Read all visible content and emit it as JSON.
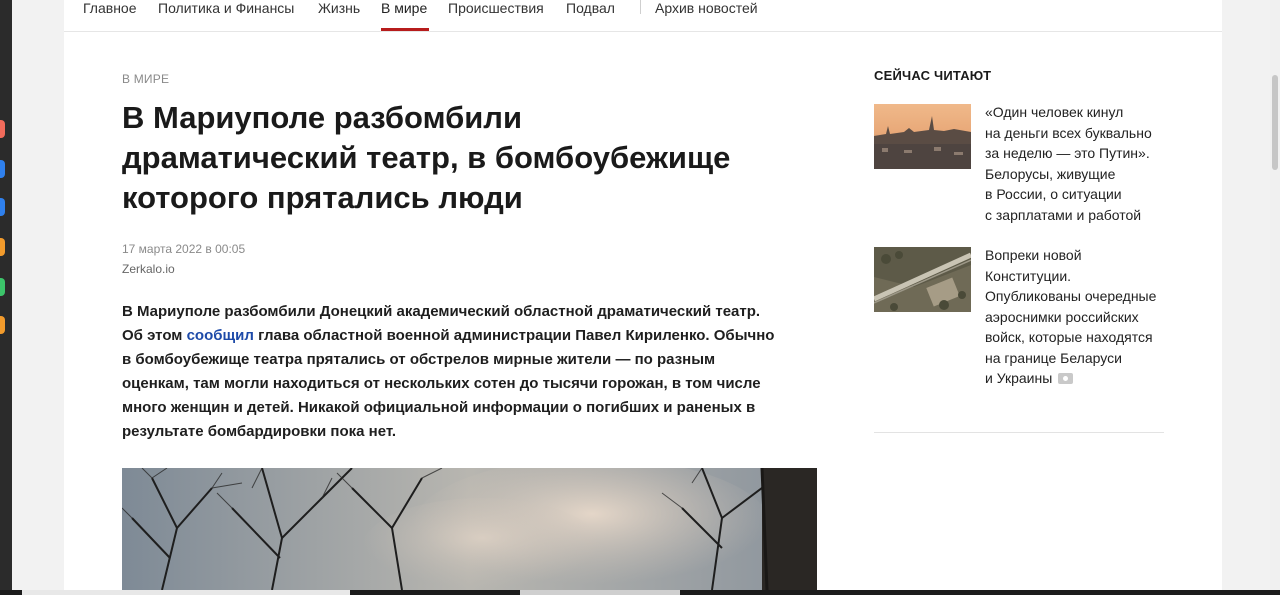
{
  "nav": {
    "items": [
      "Главное",
      "Политика и Финансы",
      "Жизнь",
      "В мире",
      "Происшествия",
      "Подвал",
      "Архив новостей"
    ],
    "active_index": 3
  },
  "article": {
    "rubric": "В МИРЕ",
    "title_lines": [
      "В Мариуполе разбомбили",
      "драматический театр, в бомбоубежище",
      "которого прятались люди"
    ],
    "date": "17 марта 2022 в 00:05",
    "source": "Zerkalo.io",
    "lead": {
      "before_link": "В Мариуполе разбомбили Донецкий академический областной драматический театр. Об этом ",
      "link": "сообщил",
      "after_link": " глава областной военной администрации Павел Кириленко. Обычно в бомбоубежище театра прятались от обстрелов мирные жители — по разным оценкам, там могли находиться от нескольких сотен до тысячи горожан, в том числе много женщин и детей. Никакой официальной информации о погибших и раненых в результате бомбардировки пока нет."
    }
  },
  "sidebar": {
    "heading": "СЕЙЧАС ЧИТАЮТ",
    "stories": [
      {
        "lines": [
          "«Один человек кинул",
          "на деньги всех буквально",
          "за неделю — это Путин».",
          "Белорусы, живущие",
          "в России, о ситуации",
          "с зарплатами и работой"
        ],
        "has_photo_icon": false
      },
      {
        "lines": [
          "Вопреки новой",
          "Конституции.",
          "Опубликованы очередные",
          "аэроснимки российских",
          "войск, которые находятся",
          "на границе Беларуси",
          "и Украины"
        ],
        "has_photo_icon": true
      }
    ]
  },
  "colors": {
    "accent": "#b71c1c",
    "link": "#1d4aa8"
  }
}
